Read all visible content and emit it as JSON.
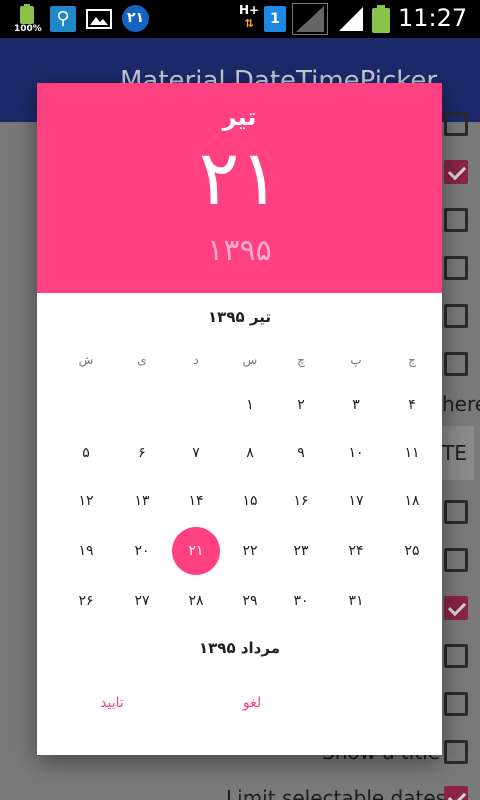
{
  "status_bar": {
    "battery_small_label": "100%",
    "usb_icon": "usb-icon",
    "image_icon": "image-icon",
    "notification_badge": "۲۱",
    "network_label": "H+",
    "network_arrows": "⇅",
    "sim_label": "1",
    "time": "11:27"
  },
  "app_bar": {
    "title": "Material DateTimePicker"
  },
  "background": {
    "hint_text": "here.",
    "button_label": "TE",
    "show_title_label": "Show a title",
    "limit_dates_label": "Limit selectable dates"
  },
  "dialog": {
    "header": {
      "month": "تیر",
      "day": "۲۱",
      "year": "۱۳۹۵"
    },
    "calendar_title": "تیر ۱۳۹۵",
    "weekdays": [
      "ج",
      "پ",
      "چ",
      "س",
      "د",
      "ی",
      "ش"
    ],
    "weeks": [
      [
        "۴",
        "۳",
        "۲",
        "۱",
        "",
        "",
        ""
      ],
      [
        "۱۱",
        "۱۰",
        "۹",
        "۸",
        "۷",
        "۶",
        "۵"
      ],
      [
        "۱۸",
        "۱۷",
        "۱۶",
        "۱۵",
        "۱۴",
        "۱۳",
        "۱۲"
      ],
      [
        "۲۵",
        "۲۴",
        "۲۳",
        "۲۲",
        "۲۱",
        "۲۰",
        "۱۹"
      ],
      [
        "",
        "۳۱",
        "۳۰",
        "۲۹",
        "۲۸",
        "۲۷",
        "۲۶"
      ]
    ],
    "selected_day": "۲۱",
    "next_month_title": "مرداد ۱۳۹۵",
    "cancel_label": "لغو",
    "ok_label": "تایید"
  },
  "colors": {
    "accent": "#ff4081",
    "app_bar": "#1c2a6b"
  }
}
